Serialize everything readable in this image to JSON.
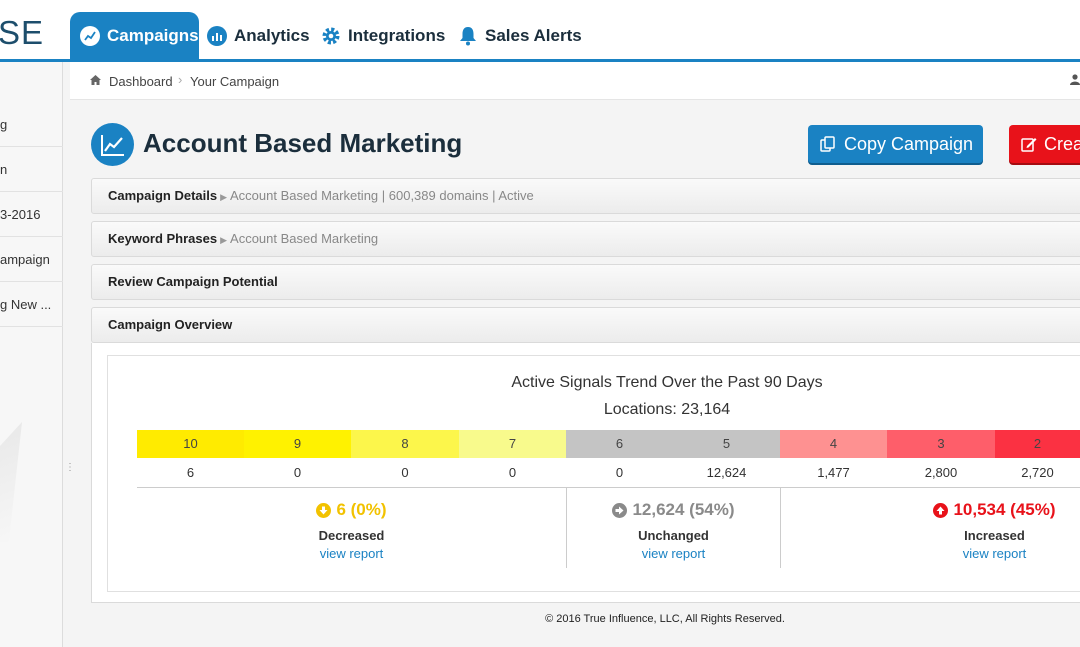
{
  "logo_fragment": "SE",
  "nav": {
    "campaigns": "Campaigns",
    "analytics": "Analytics",
    "integrations": "Integrations",
    "sales_alerts": "Sales Alerts"
  },
  "sidebar": {
    "items": [
      "g",
      "n",
      "3-2016",
      "ampaign",
      "g New ..."
    ]
  },
  "breadcrumb": {
    "home": "Dashboard",
    "current": "Your Campaign"
  },
  "page_title": "Account Based Marketing",
  "buttons": {
    "copy": "Copy Campaign",
    "create": "Crea"
  },
  "panels": {
    "details_label": "Campaign Details",
    "details_value": "Account Based Marketing | 600,389 domains | Active",
    "keywords_label": "Keyword Phrases",
    "keywords_value": "Account Based Marketing",
    "review_label": "Review Campaign Potential",
    "overview_label": "Campaign Overview"
  },
  "chart": {
    "title": "Active Signals Trend Over the Past 90 Days",
    "subtitle": "Locations: 23,164"
  },
  "signal_levels": [
    {
      "level": "10",
      "count": "6",
      "color": "#ffeb00"
    },
    {
      "level": "9",
      "count": "0",
      "color": "#fff200"
    },
    {
      "level": "8",
      "count": "0",
      "color": "#fcf64b"
    },
    {
      "level": "7",
      "count": "0",
      "color": "#f8fa8c"
    },
    {
      "level": "6",
      "count": "0",
      "color": "#c4c4c4"
    },
    {
      "level": "5",
      "count": "12,624",
      "color": "#c4c4c4"
    },
    {
      "level": "4",
      "count": "1,477",
      "color": "#fe9191"
    },
    {
      "level": "3",
      "count": "2,800",
      "color": "#fe5e6a"
    },
    {
      "level": "2",
      "count": "2,720",
      "color": "#fb3142"
    }
  ],
  "summary": {
    "decreased": {
      "value": "6 (0%)",
      "label": "Decreased",
      "link": "view report",
      "color": "#f2c200"
    },
    "unchanged": {
      "value": "12,624 (54%)",
      "label": "Unchanged",
      "link": "view report",
      "color": "#8a8a8a"
    },
    "increased": {
      "value": "10,534 (45%)",
      "label": "Increased",
      "link": "view report",
      "color": "#e8121a"
    }
  },
  "footer": "© 2016 True Influence, LLC, All Rights Reserved."
}
